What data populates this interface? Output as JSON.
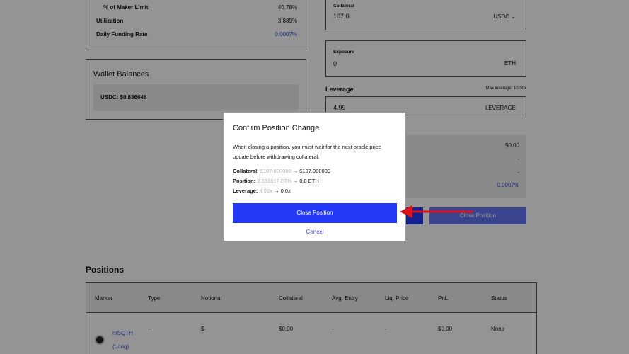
{
  "stats": {
    "maker_limit_label": "% of Maker Limit",
    "maker_limit_value": "40.78%",
    "utilization_label": "Utilization",
    "utilization_value": "3.889%",
    "funding_label": "Daily Funding Rate",
    "funding_value": "0.0007%"
  },
  "wallet": {
    "title": "Wallet Balances",
    "usdc_line": "USDC: $0.836648"
  },
  "form": {
    "collateral_label": "Collateral",
    "collateral_value": "107.0",
    "collateral_unit": "USDC ⌄",
    "exposure_label": "Exposure",
    "exposure_value": "0",
    "exposure_unit": "ETH",
    "leverage_label": "Leverage",
    "leverage_max": "Max leverage: 10.00x",
    "leverage_value": "4.99",
    "leverage_unit": "LEVERAGE"
  },
  "summary": {
    "v1": "$0.00",
    "v2": "-",
    "v3": "-",
    "v4": "0.0007%"
  },
  "background_buttons": {
    "close_position": "Close Position"
  },
  "positions": {
    "title": "Positions",
    "columns": [
      "Market",
      "Type",
      "Notional",
      "Collateral",
      "Avg. Entry",
      "Liq. Price",
      "PnL",
      "Status"
    ],
    "row": {
      "market": "mSQTH",
      "market_side": "(Long)",
      "type": "--",
      "notional": "$-",
      "collateral": "$0.00",
      "avg_entry": "-",
      "liq_price": "-",
      "pnl": "$0.00",
      "status": "None"
    }
  },
  "modal": {
    "title": "Confirm Position Change",
    "description": "When closing a position, you must wait for the next oracle price update before withdrawing collateral.",
    "collateral_label": "Collateral:",
    "collateral_old": "$107.000000",
    "collateral_new": "→ $107.000000",
    "position_label": "Position:",
    "position_old": "0.331817 ETH",
    "position_new": "→ 0.0 ETH",
    "leverage_label": "Leverage:",
    "leverage_old": "4.99x",
    "leverage_new": "→ 0.0x",
    "confirm_button": "Close Position",
    "cancel_button": "Cancel"
  },
  "colors": {
    "accent_blue": "#2439f5",
    "link_blue": "#3a4fd8",
    "arrow_red": "#e0101a"
  }
}
